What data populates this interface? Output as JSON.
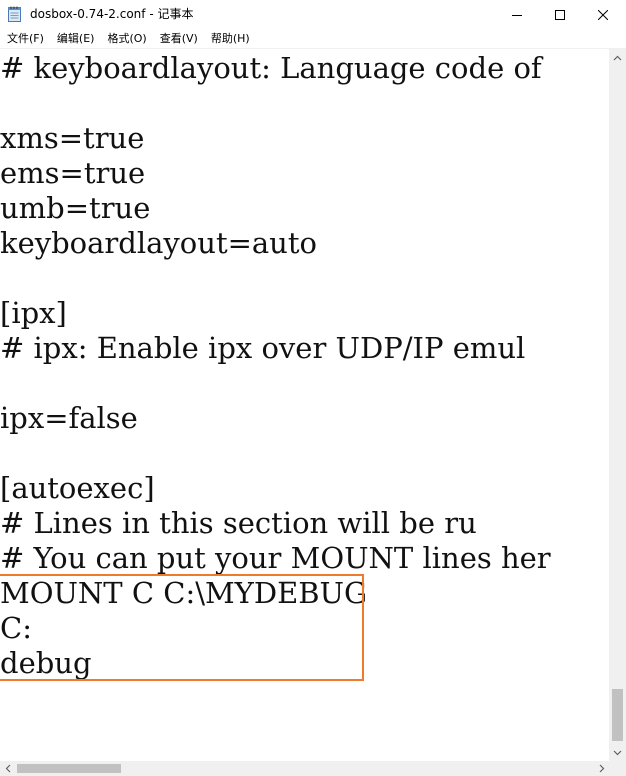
{
  "window": {
    "title": "dosbox-0.74-2.conf - 记事本",
    "icon": "notepad-icon"
  },
  "menu": [
    {
      "label": "文件(F)"
    },
    {
      "label": "编辑(E)"
    },
    {
      "label": "格式(O)"
    },
    {
      "label": "查看(V)"
    },
    {
      "label": "帮助(H)"
    }
  ],
  "editor": {
    "lines": [
      "# keyboardlayout: Language code of",
      "",
      "xms=true",
      "ems=true",
      "umb=true",
      "keyboardlayout=auto",
      "",
      "[ipx]",
      "# ipx: Enable ipx over UDP/IP emul",
      "",
      "ipx=false",
      "",
      "[autoexec]",
      "# Lines in this section will be ru",
      "# You can put your MOUNT lines her",
      "MOUNT C C:\\MYDEBUG",
      "C:",
      "debug"
    ],
    "highlight_color": "#ee7a2b"
  }
}
